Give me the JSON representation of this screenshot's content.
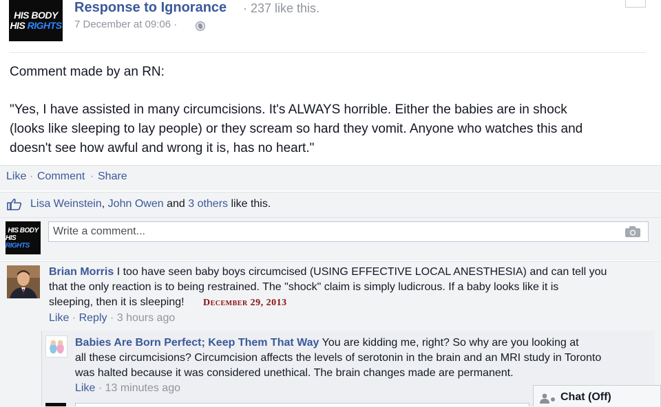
{
  "post": {
    "page_logo": {
      "line1": "HIS BODY",
      "line2a": "HIS",
      "line2b": "RIGHTS"
    },
    "page_name": "Response to Ignorance",
    "like_count_text": "· 237 like this.",
    "timestamp": "7 December at 09:06 ·",
    "body_lines": [
      "Comment made by an RN:",
      "\"Yes, I have assisted in many circumcisions. It's ALWAYS horrible. Either the babies are in shock",
      "(looks like sleeping to lay people) or they scream so hard they vomit. Anyone who watches this and",
      "doesn't see how awful and wrong it is, has no heart.\""
    ]
  },
  "actions": {
    "like": "Like",
    "comment": "Comment",
    "share": "Share",
    "sep": "·"
  },
  "likes": {
    "name1": "Lisa Weinstein",
    "comma": ",",
    "name2": "John Owen",
    "and": "and",
    "others": "3 others",
    "suffix": "like this."
  },
  "composer": {
    "placeholder": "Write a comment..."
  },
  "comments": [
    {
      "author": "Brian Morris",
      "lines": [
        "I too have seen baby boys circumcised (USING EFFECTIVE LOCAL ANESTHESIA) and can tell you",
        "that the only reaction is to being restrained. The \"shock\" claim is simply ludicrous. If a baby looks like it is",
        "sleeping, then it is sleeping!"
      ],
      "stamp": "December 29, 2013",
      "like": "Like",
      "reply": "Reply",
      "time": "3 hours ago"
    }
  ],
  "reply": {
    "author": "Babies Are Born Perfect; Keep Them That Way",
    "lines": [
      "You are kidding me, right? So why are you looking at",
      "all these circumcisions? Circumcision affects the levels of serotonin in the brain and an MRI study in Toronto",
      "was halted because it was considered unethical. The brain changes made are permanent."
    ],
    "like": "Like",
    "time": "13 minutes ago"
  },
  "chat": {
    "label": "Chat (Off)"
  },
  "colors": {
    "link": "#3b5998",
    "muted": "#90949c",
    "stamp": "#8b1010",
    "ufi_bg": "#f2f3f5"
  },
  "icons": [
    "globe-icon",
    "thumbs-up-icon",
    "camera-icon",
    "chat-people-icon",
    "chevron-down-icon"
  ]
}
